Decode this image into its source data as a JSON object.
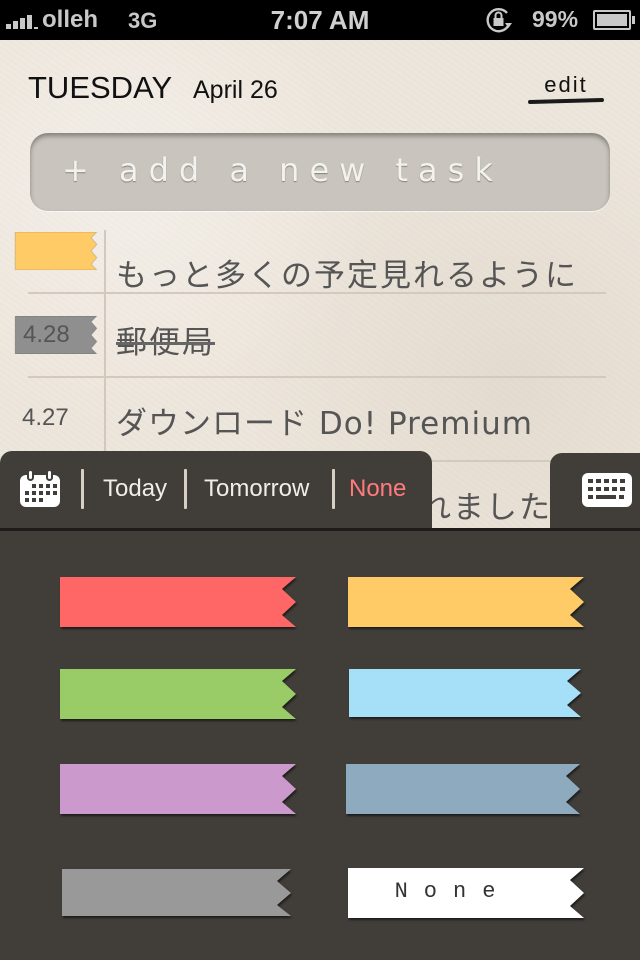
{
  "status_bar": {
    "carrier": "olleh",
    "network": "3G",
    "time": "7:07 AM",
    "battery_percent": "99%",
    "icons": [
      "signal-bars-icon",
      "rotation-lock-icon",
      "battery-icon"
    ]
  },
  "header": {
    "day": "TUESDAY",
    "date": "April 26",
    "edit_label": "edit"
  },
  "add_task": {
    "placeholder": "+ add a new task"
  },
  "tasks": [
    {
      "text": "もっと多くの予定見れるように",
      "date": "",
      "tag_color": "#ffcb66",
      "done": false
    },
    {
      "text": "郵便局",
      "date": "4.28",
      "tag_color": "#8f8f8f",
      "done": true
    },
    {
      "text": "ダウンロード Do! Premium",
      "date": "4.27",
      "tag_color": "",
      "done": false
    },
    {
      "text": "れました",
      "date": "",
      "tag_color": "",
      "done": false
    }
  ],
  "toolbar": {
    "calendar_icon": "calendar-icon",
    "today_label": "Today",
    "tomorrow_label": "Tomorrow",
    "none_label": "None",
    "none_color": "#ff7b7b",
    "keyboard_icon": "keyboard-icon"
  },
  "color_panel": {
    "swatches": [
      {
        "name": "red",
        "color": "#ff6666",
        "label": ""
      },
      {
        "name": "yellow",
        "color": "#ffcb66",
        "label": ""
      },
      {
        "name": "green",
        "color": "#99cc66",
        "label": ""
      },
      {
        "name": "light-blue",
        "color": "#a6e0f8",
        "label": ""
      },
      {
        "name": "purple",
        "color": "#cc99cc",
        "label": ""
      },
      {
        "name": "slate-blue",
        "color": "#8eaabe",
        "label": ""
      },
      {
        "name": "gray",
        "color": "#999999",
        "label": ""
      },
      {
        "name": "none",
        "color": "#ffffff",
        "label": "None"
      }
    ]
  }
}
